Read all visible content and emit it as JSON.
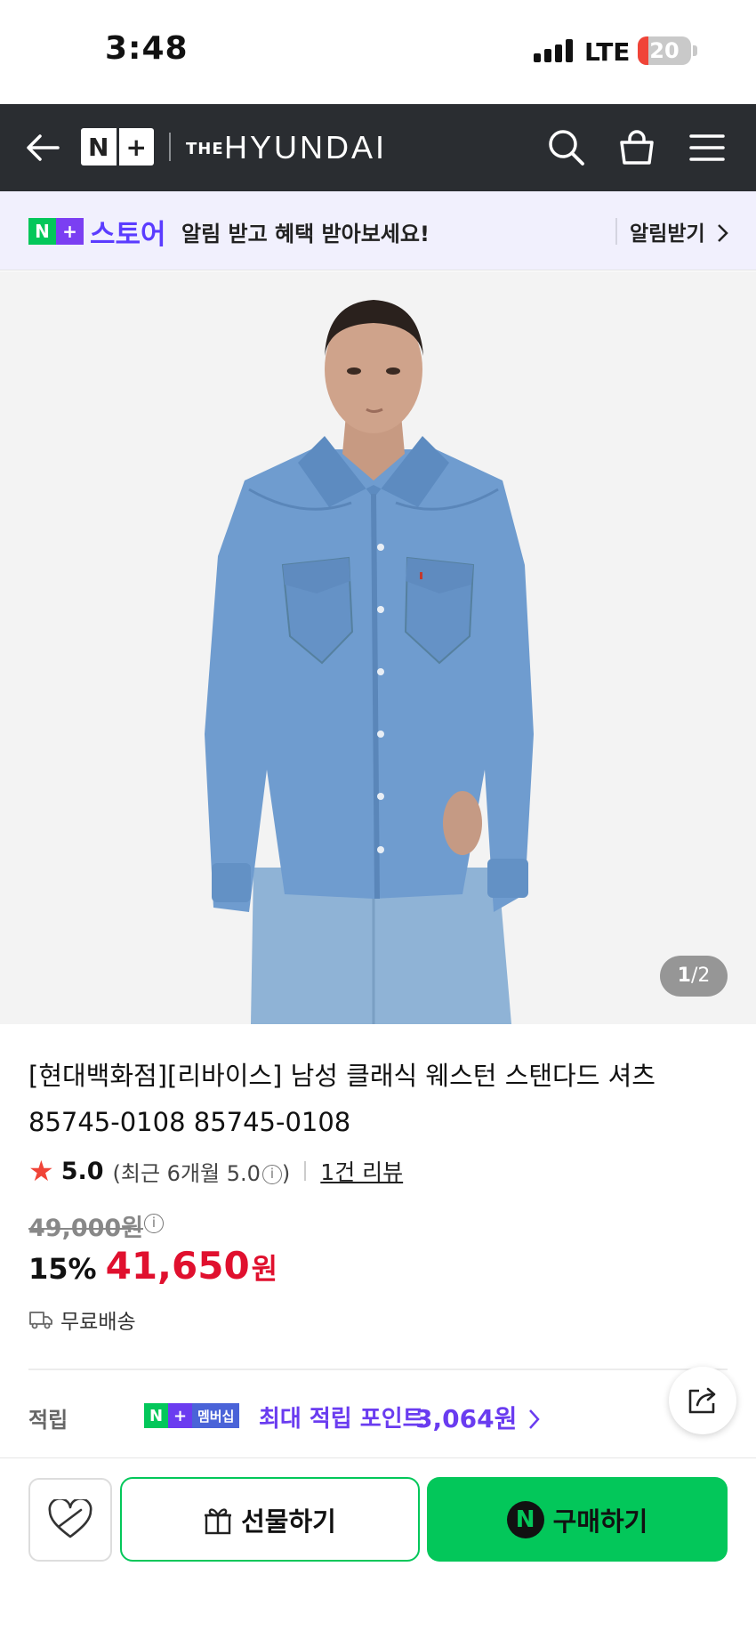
{
  "status_bar": {
    "time": "3:48",
    "network": "LTE",
    "battery": "20",
    "battery_level": 0.2
  },
  "header": {
    "logo_np": [
      "N",
      "+"
    ],
    "logo_the": "THE",
    "logo_brand": "HYUNDAI",
    "icons": [
      "back-arrow-icon",
      "search-icon",
      "shopping-bag-icon",
      "menu-icon"
    ]
  },
  "banner": {
    "badge": [
      "N",
      "+"
    ],
    "store": "스토어",
    "message": "알림 받고 혜택 받아보세요!",
    "cta": "알림받기"
  },
  "product": {
    "image_counter_current": "1",
    "image_counter_total": "/2",
    "title": "[현대백화점][리바이스] 남성 클래식 웨스턴 스탠다드 셔츠 85745-0108 85745-0108",
    "rating_score": "5.0",
    "rating_recent_prefix": "(최근 6개월 5.0",
    "rating_recent_suffix": ")",
    "review_link": "1건 리뷰",
    "original_price": "49,000원",
    "discount": "15%",
    "sale_price": "41,650",
    "currency": "원",
    "shipping": "무료배송"
  },
  "points": {
    "label": "적립",
    "badge_n": "N",
    "badge_plus": "+",
    "badge_membership": "멤버십",
    "text": "최대 적립 포인트",
    "amount": "3,064원"
  },
  "actions": {
    "gift_label": "선물하기",
    "buy_icon": "N",
    "buy_label": "구매하기"
  },
  "colors": {
    "header_bg": "#2a2d31",
    "naver_green": "#03c75a",
    "naver_purple": "#6b3cf0",
    "sale_red": "#e0102e",
    "banner_bg": "#f1f0fd"
  }
}
